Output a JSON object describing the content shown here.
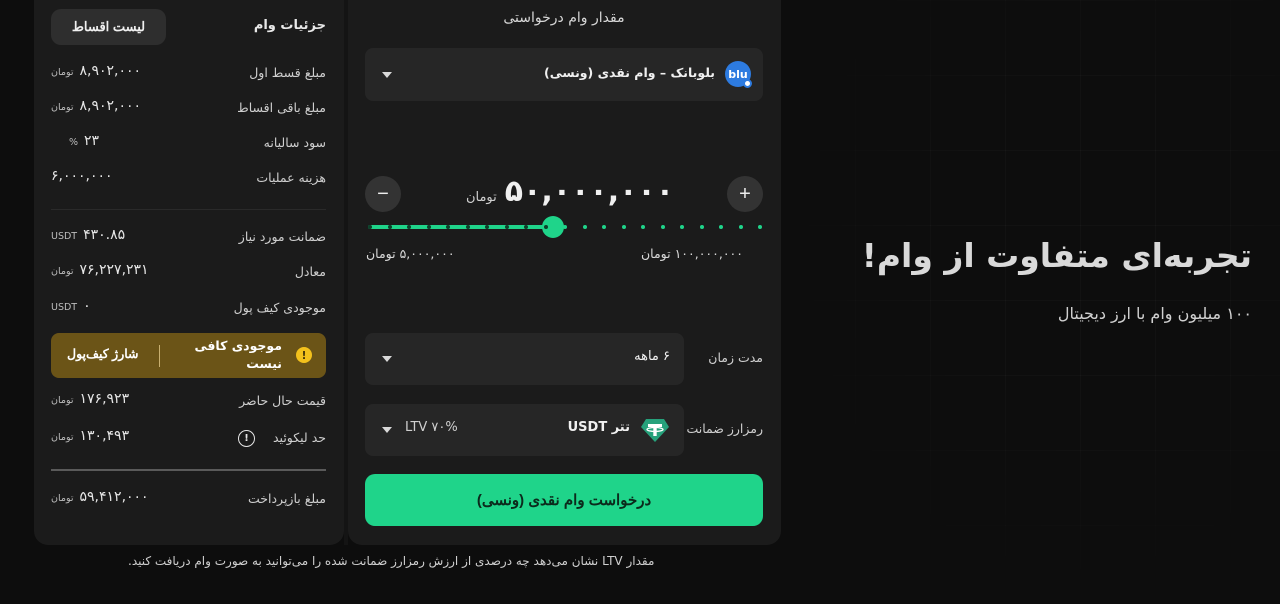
{
  "hero": {
    "title": "تجربه‌ای متفاوت از وام!",
    "subtitle": "۱۰۰ میلیون وام با ارز دیجیتال"
  },
  "details": {
    "title": "جزئیات وام",
    "installments_button": "لیست اقساط",
    "rows": [
      {
        "label": "مبلغ قسط اول",
        "value": "۸,۹۰۲,۰۰۰",
        "unit": "تومان"
      },
      {
        "label": "مبلغ باقی اقساط",
        "value": "۸,۹۰۲,۰۰۰",
        "unit": "تومان"
      },
      {
        "label": "سود سالیانه",
        "value": "۲۳",
        "unit": "%"
      },
      {
        "label": "هزینه عملیات",
        "value": "۶,۰۰۰,۰۰۰",
        "unit": ""
      },
      {
        "label": "ضمانت مورد نیاز",
        "value": "۴۳۰.۸۵",
        "unit": "USDT"
      },
      {
        "label": "معادل",
        "value": "۷۶,۲۲۷,۲۳۱",
        "unit": "تومان"
      },
      {
        "label": "موجودی کیف پول",
        "value": "۰",
        "unit": "USDT"
      },
      {
        "label": "قیمت حال حاضر",
        "value": "۱۷۶,۹۲۳",
        "unit": "تومان"
      },
      {
        "label": "حد لیکوئید",
        "value": "۱۳۰,۴۹۳",
        "unit": "تومان"
      },
      {
        "label": "مبلغ بازپرداخت",
        "value": "۵۹,۴۱۲,۰۰۰",
        "unit": "تومان"
      }
    ],
    "warning": {
      "icon": "!",
      "text": "موجودی کافی نیست",
      "action": "شارژ کیف‌پول"
    },
    "info_icon": "!"
  },
  "request": {
    "title": "مقدار وام درخواستی",
    "bank": {
      "logo": "blu",
      "label": "بلوبانک – وام نقدی (ونسی)"
    },
    "amount": {
      "value": "۵۰,۰۰۰,۰۰۰",
      "unit": "تومان",
      "minus": "−",
      "plus": "+",
      "min_label": "۵,۰۰۰,۰۰۰ تومان",
      "max_label": "۱۰۰,۰۰۰,۰۰۰ تومان",
      "slider_fraction": 0.47
    },
    "duration": {
      "label": "مدت زمان",
      "value": "۶ ماهه"
    },
    "collateral": {
      "label": "رمزارز ضمانت",
      "value": "تتر USDT",
      "ltv": "LTV ۷۰%"
    },
    "submit": "درخواست وام نقدی (ونسی)",
    "footnote": "مقدار LTV نشان می‌دهد چه درصدی از ارزش رمزارز ضمانت شده را می‌توانید به صورت وام دریافت کنید."
  },
  "colors": {
    "accent": "#1fd48a",
    "warning_bg": "#6b5417",
    "warning_icon": "#f3c11c",
    "bank_blue": "#2d7be0",
    "tether": "#26a17b"
  }
}
